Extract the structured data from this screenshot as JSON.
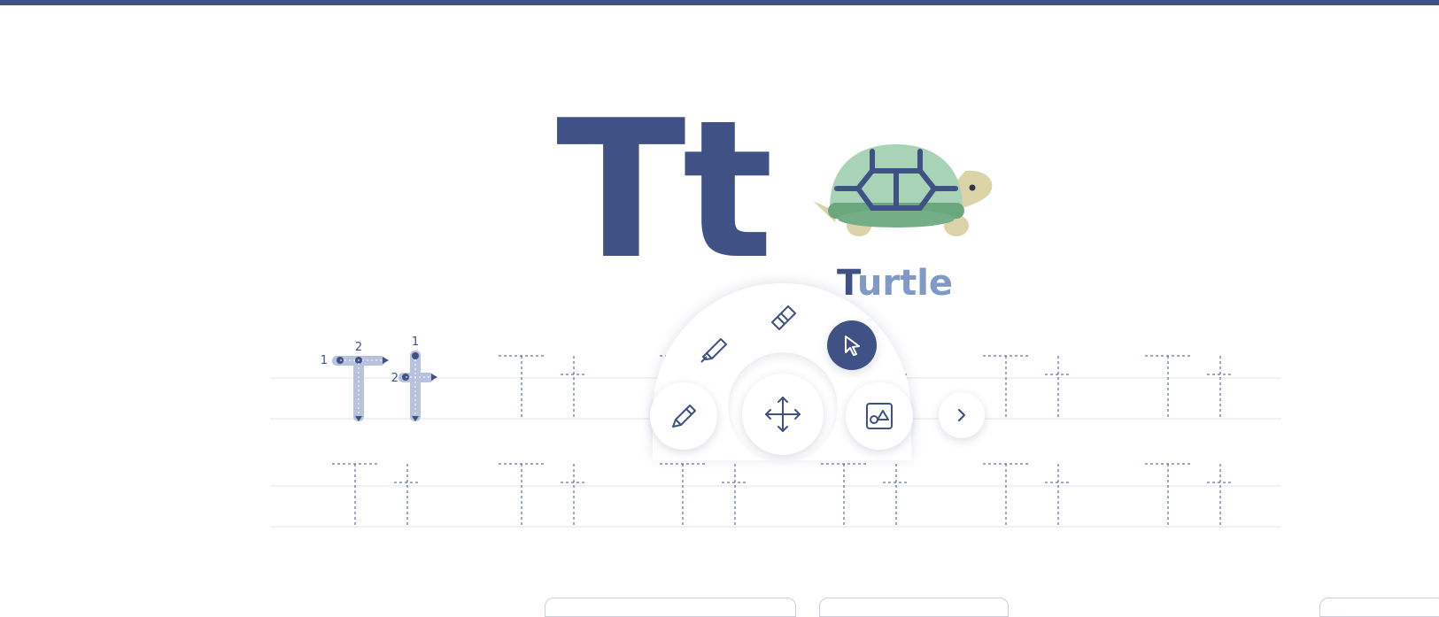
{
  "letter": {
    "display": "Tt",
    "word_first": "T",
    "word_rest": "urtle"
  },
  "stroke_guides": {
    "upper": {
      "step1": "1",
      "step2": "2"
    },
    "lower": {
      "step1": "1",
      "step2": "2"
    }
  },
  "practice": {
    "rows": 2,
    "cells_per_row": 6,
    "guide_letters": "Tt"
  },
  "toolbar": {
    "tools": [
      "pencil-icon",
      "highlighter-icon",
      "eraser-icon",
      "pointer-icon",
      "move-icon",
      "shapes-icon",
      "chevron-right-icon"
    ],
    "active_tool": "pointer-icon"
  },
  "colors": {
    "accent": "#3f5185",
    "light_accent": "#7f9ac6",
    "guide": "#b7c3dc",
    "turtle_shell": "#a8d3b6",
    "turtle_band": "#6aa77c",
    "turtle_body": "#ddd3a9"
  }
}
